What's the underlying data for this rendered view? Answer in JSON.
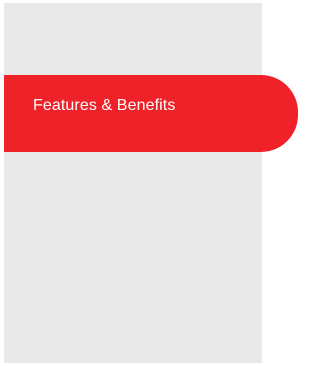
{
  "menu": {
    "active_item": {
      "label": "Features & Benefits"
    }
  },
  "colors": {
    "panel_background": "#e9e9e9",
    "active_tab": "#ef2229",
    "active_tab_text": "#ffffff"
  }
}
